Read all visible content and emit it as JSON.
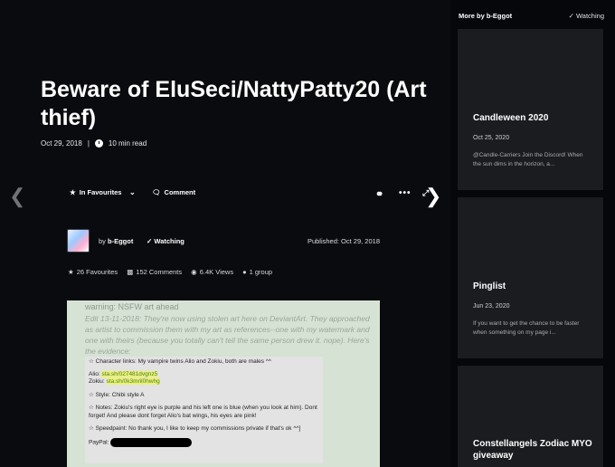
{
  "article": {
    "title": "Beware of EluSeci/NattyPatty20 (Art thief)",
    "date": "Oct 29, 2018",
    "separator": "|",
    "read_time": "10 min read"
  },
  "actions": {
    "favourite_label": "In Favourites",
    "comment_label": "Comment"
  },
  "author": {
    "by": "by",
    "name": "b-Eggot",
    "watching": "Watching",
    "published": "Published: Oct 29, 2018"
  },
  "stats": {
    "favourites": "26 Favourites",
    "comments": "152 Comments",
    "views": "6.4K Views",
    "groups": "1 group"
  },
  "image_text": {
    "warning": "warning: NSFW art ahead",
    "edit": "Edit 13-11-2018: They're now using stolen art here on DeviantArt. They approached as artist to commission them with my art as references--one with my watermark and one with theirs (because you totally can't tell the same person drew it. nope). Here's the evidence:",
    "line1": "☆ Character links: My vampire twins Alio and Zokiu, both are males ^^",
    "alio_label": "Alio: ",
    "alio_link": "sta.sh/027481dvgnz5",
    "zokiu_label": "Zokiu: ",
    "zokiu_link": "sta.sh/0k3mril0hwhg",
    "style": "☆ Style: Chibi style A",
    "notes": "☆ Notes: Zokiu's right eye is purple and his left one is blue (when you look at him). Dont forget! And please dont forget Alio's bat wings, his eyes are pink!",
    "speedpaint": "☆ Speedpaint: No thank you, I like to keep my commissions private if that's ok ^^]",
    "paypal": "PayPal:"
  },
  "sidebar": {
    "heading": "More by b-Eggot",
    "watching": "Watching",
    "cards": [
      {
        "title": "Candleween 2020",
        "date": "Oct 25, 2020",
        "excerpt": "@Candle-Carriers Join the Discord! When the sun dims in the horizon, a..."
      },
      {
        "title": "Pinglist",
        "date": "Jun 23, 2020",
        "excerpt": "If you want to get the chance to be faster when something on my page i..."
      },
      {
        "title": "Constellangels Zodiac MYO giveaway"
      }
    ]
  },
  "icons": [
    "chevron-left-icon",
    "chevron-right-icon",
    "star-icon",
    "chevron-down-icon",
    "comment-icon",
    "share-icon",
    "more-icon",
    "expand-icon",
    "clock-icon",
    "check-icon",
    "eye-icon",
    "group-icon"
  ]
}
